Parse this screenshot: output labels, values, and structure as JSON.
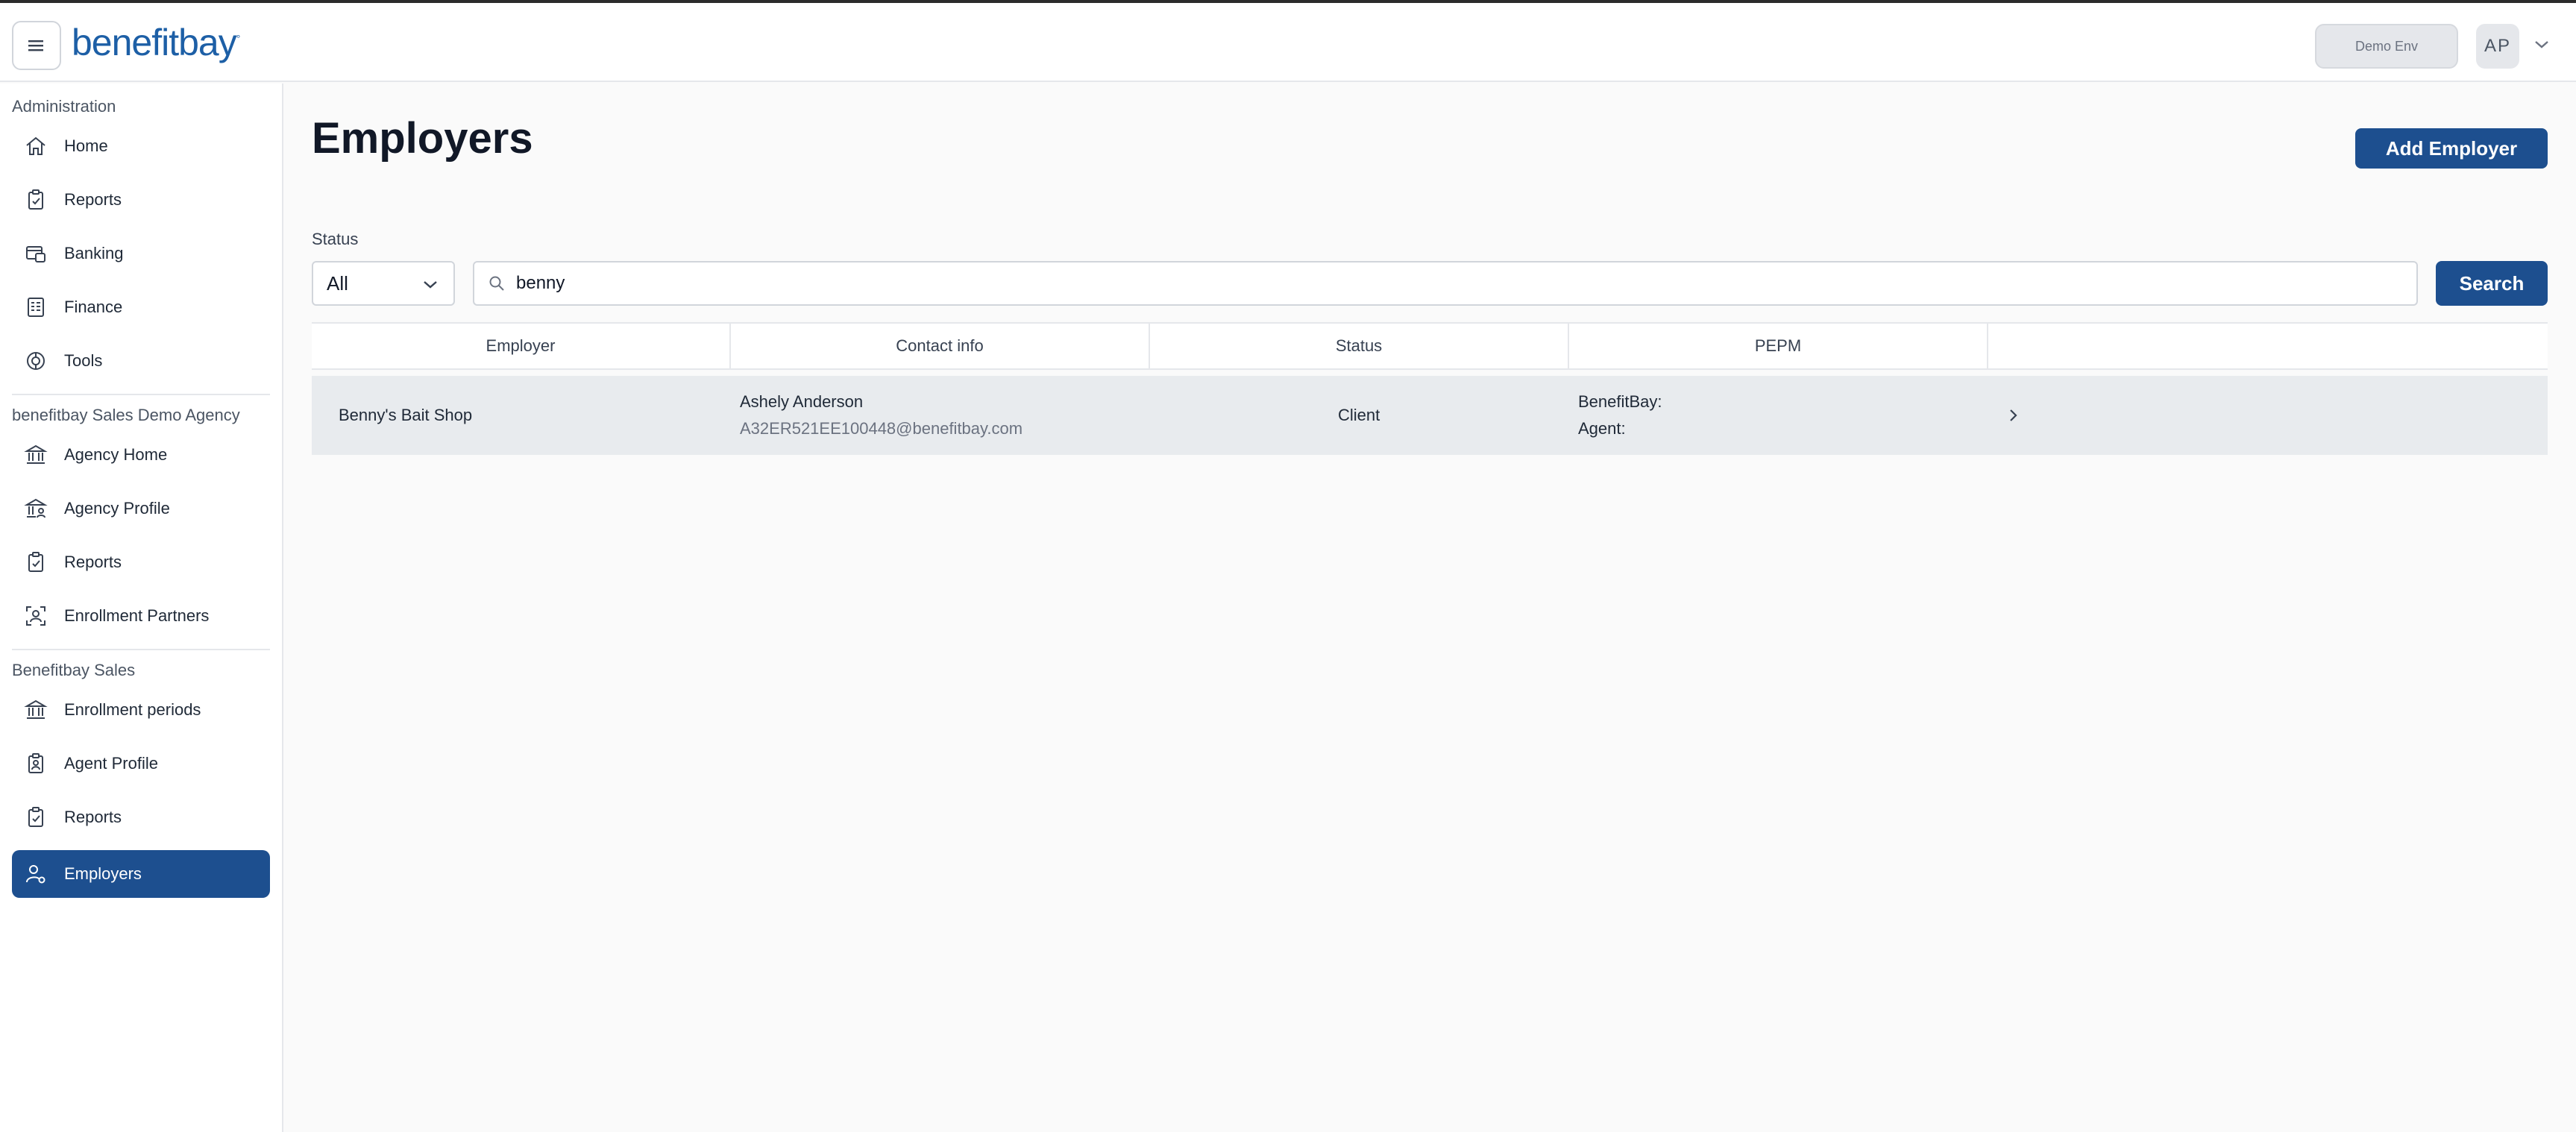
{
  "app": {
    "brand": "benefitbay",
    "env_badge": "Demo Env",
    "avatar_initials": "AP"
  },
  "sidebar": {
    "sections": [
      {
        "title": "Administration",
        "items": [
          {
            "label": "Home",
            "icon": "home-icon"
          },
          {
            "label": "Reports",
            "icon": "clipboard-check-icon"
          },
          {
            "label": "Banking",
            "icon": "bank-card-icon"
          },
          {
            "label": "Finance",
            "icon": "ledger-icon"
          },
          {
            "label": "Tools",
            "icon": "tools-icon"
          }
        ]
      },
      {
        "title": "benefitbay Sales Demo Agency",
        "items": [
          {
            "label": "Agency Home",
            "icon": "institution-icon"
          },
          {
            "label": "Agency Profile",
            "icon": "agency-profile-icon"
          },
          {
            "label": "Reports",
            "icon": "clipboard-check-icon"
          },
          {
            "label": "Enrollment Partners",
            "icon": "partners-icon"
          }
        ]
      },
      {
        "title": "Benefitbay Sales",
        "items": [
          {
            "label": "Enrollment periods",
            "icon": "institution-icon"
          },
          {
            "label": "Agent Profile",
            "icon": "badge-icon"
          },
          {
            "label": "Reports",
            "icon": "clipboard-check-icon"
          },
          {
            "label": "Employers",
            "icon": "user-gear-icon",
            "active": true
          }
        ]
      }
    ]
  },
  "main": {
    "title": "Employers",
    "add_button": "Add Employer",
    "filter": {
      "status_label": "Status",
      "status_value": "All",
      "search_value": "benny",
      "search_button": "Search"
    },
    "table": {
      "columns": [
        "Employer",
        "Contact info",
        "Status",
        "PEPM",
        ""
      ],
      "rows": [
        {
          "employer": "Benny's Bait Shop",
          "contact_name": "Ashely Anderson",
          "contact_email": "A32ER521EE100448@benefitbay.com",
          "status": "Client",
          "pepm_benefitbay": "BenefitBay:",
          "pepm_agent": "Agent:"
        }
      ]
    }
  },
  "colors": {
    "brand_blue": "#1d4f8f",
    "logo_blue": "#1d5fa6",
    "row_bg": "#e8ebee"
  }
}
